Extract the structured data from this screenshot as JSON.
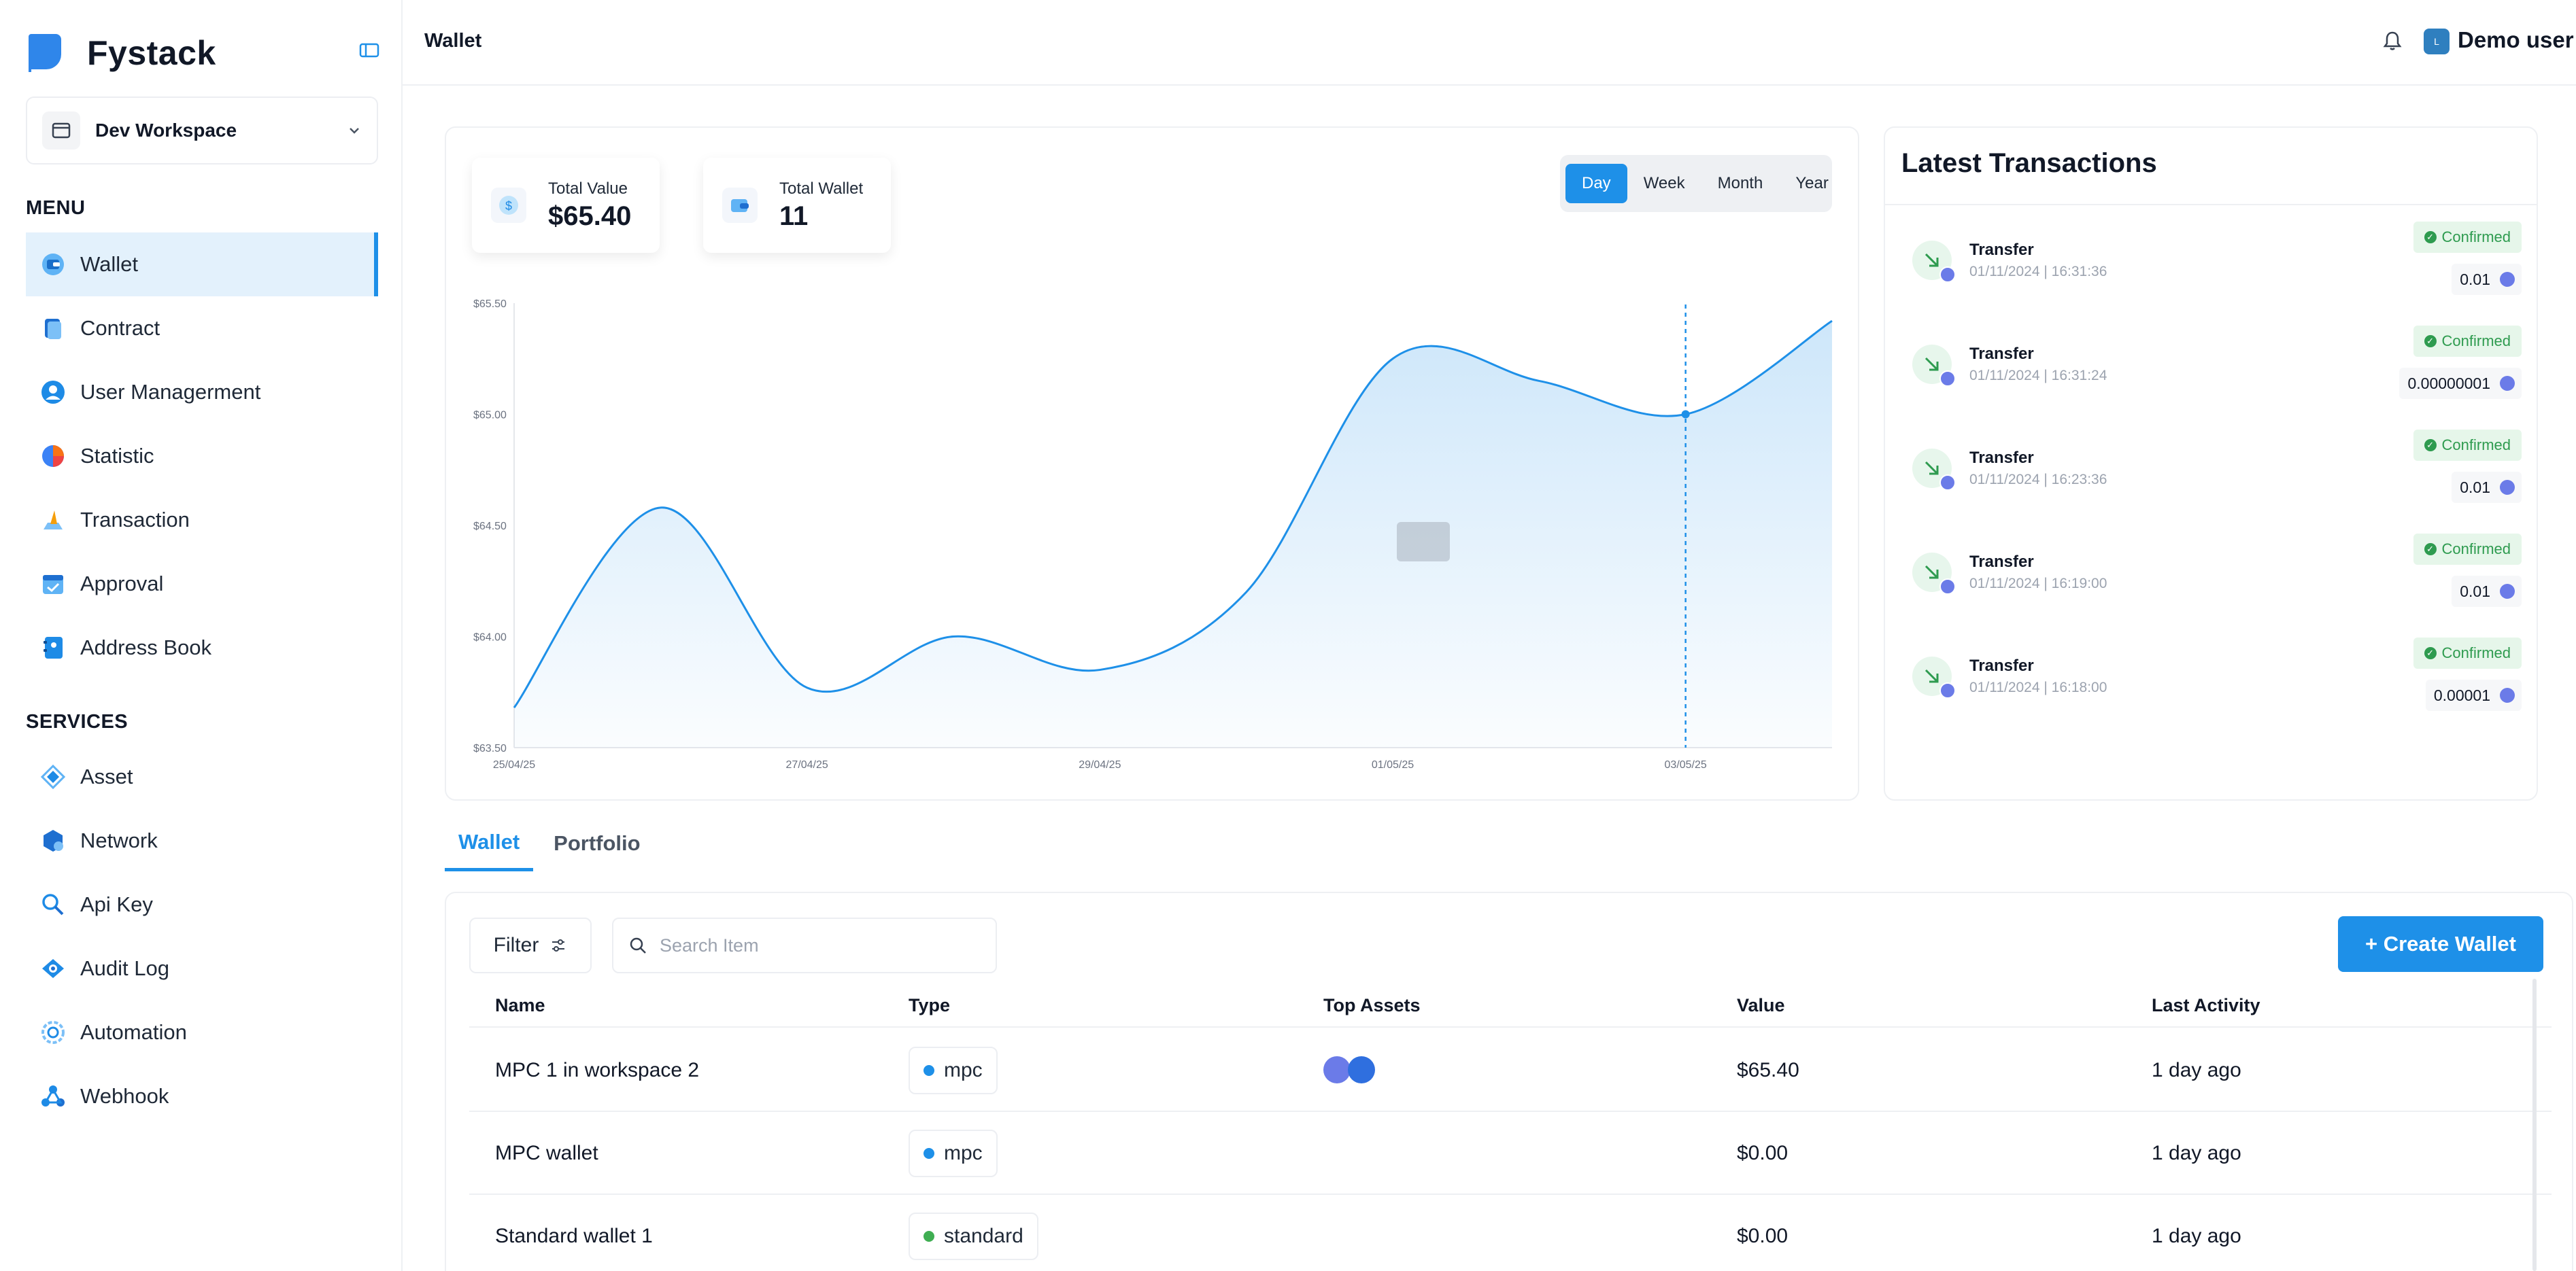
{
  "brand": {
    "name": "Fystack",
    "accent": "#1e90e8"
  },
  "workspace": {
    "name": "Dev Workspace"
  },
  "sidebar": {
    "menu_label": "MENU",
    "menu": [
      {
        "label": "Wallet",
        "icon": "wallet-icon",
        "active": true
      },
      {
        "label": "Contract",
        "icon": "contract-icon"
      },
      {
        "label": "User Managerment",
        "icon": "user-icon"
      },
      {
        "label": "Statistic",
        "icon": "pie-chart-icon"
      },
      {
        "label": "Transaction",
        "icon": "transaction-icon"
      },
      {
        "label": "Approval",
        "icon": "approval-icon"
      },
      {
        "label": "Address Book",
        "icon": "address-book-icon"
      }
    ],
    "services_label": "SERVICES",
    "services": [
      {
        "label": "Asset",
        "icon": "asset-icon"
      },
      {
        "label": "Network",
        "icon": "network-icon"
      },
      {
        "label": "Api Key",
        "icon": "api-key-icon"
      },
      {
        "label": "Audit Log",
        "icon": "audit-log-icon"
      },
      {
        "label": "Automation",
        "icon": "automation-icon"
      },
      {
        "label": "Webhook",
        "icon": "webhook-icon"
      }
    ]
  },
  "header": {
    "title": "Wallet",
    "user_name": "Demo user",
    "user_initial": "L"
  },
  "summary": {
    "total_value_label": "Total Value",
    "total_value": "$65.40",
    "total_wallet_label": "Total Wallet",
    "total_wallet": "11"
  },
  "periods": [
    "Day",
    "Week",
    "Month",
    "Year"
  ],
  "active_period": "Day",
  "chart_data": {
    "type": "area",
    "x": [
      "25/04/25",
      "26/04/25",
      "27/04/25",
      "28/04/25",
      "29/04/25",
      "30/04/25",
      "01/05/25",
      "02/05/25",
      "03/05/25",
      "04/05/25"
    ],
    "x_ticks": [
      "25/04/25",
      "27/04/25",
      "29/04/25",
      "01/05/25",
      "03/05/25"
    ],
    "series": [
      {
        "values": [
          63.68,
          64.58,
          63.77,
          64.0,
          63.85,
          64.2,
          65.25,
          65.15,
          65.0,
          65.42
        ]
      }
    ],
    "y_ticks": [
      "$65.50",
      "$65.00",
      "$64.50",
      "$64.00",
      "$63.50"
    ],
    "ylim": [
      63.5,
      65.5
    ],
    "hover_x": "03/05/25",
    "line_color": "#1e90e8",
    "grid": false
  },
  "transactions": {
    "title": "Latest Transactions",
    "items": [
      {
        "name": "Transfer",
        "time": "01/11/2024 | 16:31:36",
        "status": "Confirmed",
        "amount": "0.01"
      },
      {
        "name": "Transfer",
        "time": "01/11/2024 | 16:31:24",
        "status": "Confirmed",
        "amount": "0.00000001"
      },
      {
        "name": "Transfer",
        "time": "01/11/2024 | 16:23:36",
        "status": "Confirmed",
        "amount": "0.01"
      },
      {
        "name": "Transfer",
        "time": "01/11/2024 | 16:19:00",
        "status": "Confirmed",
        "amount": "0.01"
      },
      {
        "name": "Transfer",
        "time": "01/11/2024 | 16:18:00",
        "status": "Confirmed",
        "amount": "0.00001"
      }
    ]
  },
  "tabs": [
    "Wallet",
    "Portfolio"
  ],
  "table": {
    "filter_label": "Filter",
    "search_placeholder": "Search Item",
    "create_label": "+ Create Wallet",
    "columns": [
      "Name",
      "Type",
      "Top Assets",
      "Value",
      "Last Activity"
    ],
    "rows": [
      {
        "name": "MPC 1 in workspace 2",
        "type": "mpc",
        "type_color": "#1e90e8",
        "value": "$65.40",
        "last_activity": "1 day ago",
        "assets": [
          "eth",
          "usdc"
        ]
      },
      {
        "name": "MPC wallet",
        "type": "mpc",
        "type_color": "#1e90e8",
        "value": "$0.00",
        "last_activity": "1 day ago",
        "assets": []
      },
      {
        "name": "Standard wallet 1",
        "type": "standard",
        "type_color": "#3fae52",
        "value": "$0.00",
        "last_activity": "1 day ago",
        "assets": []
      }
    ]
  }
}
